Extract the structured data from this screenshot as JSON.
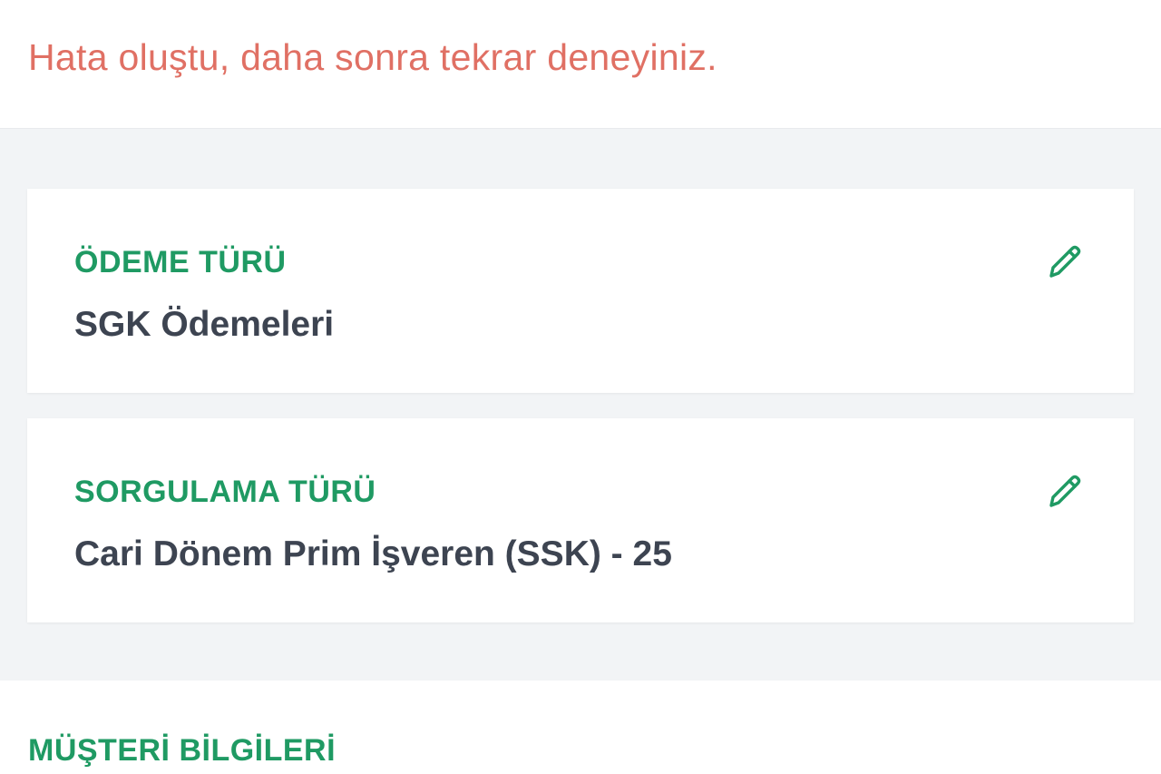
{
  "error": {
    "message": "Hata oluştu, daha sonra tekrar deneyiniz.",
    "color": "#e07064"
  },
  "cards": [
    {
      "label": "ÖDEME TÜRÜ",
      "value": "SGK Ödemeleri",
      "edit_icon": "pencil-icon"
    },
    {
      "label": "SORGULAMA TÜRÜ",
      "value": "Cari Dönem Prim İşveren (SSK) - 25",
      "edit_icon": "pencil-icon"
    }
  ],
  "customer_section": {
    "title": "MÜŞTERİ BİLGİLERİ"
  },
  "colors": {
    "accent_green": "#1f9a63",
    "value_text": "#3d4451",
    "background_gray": "#f2f4f6"
  }
}
